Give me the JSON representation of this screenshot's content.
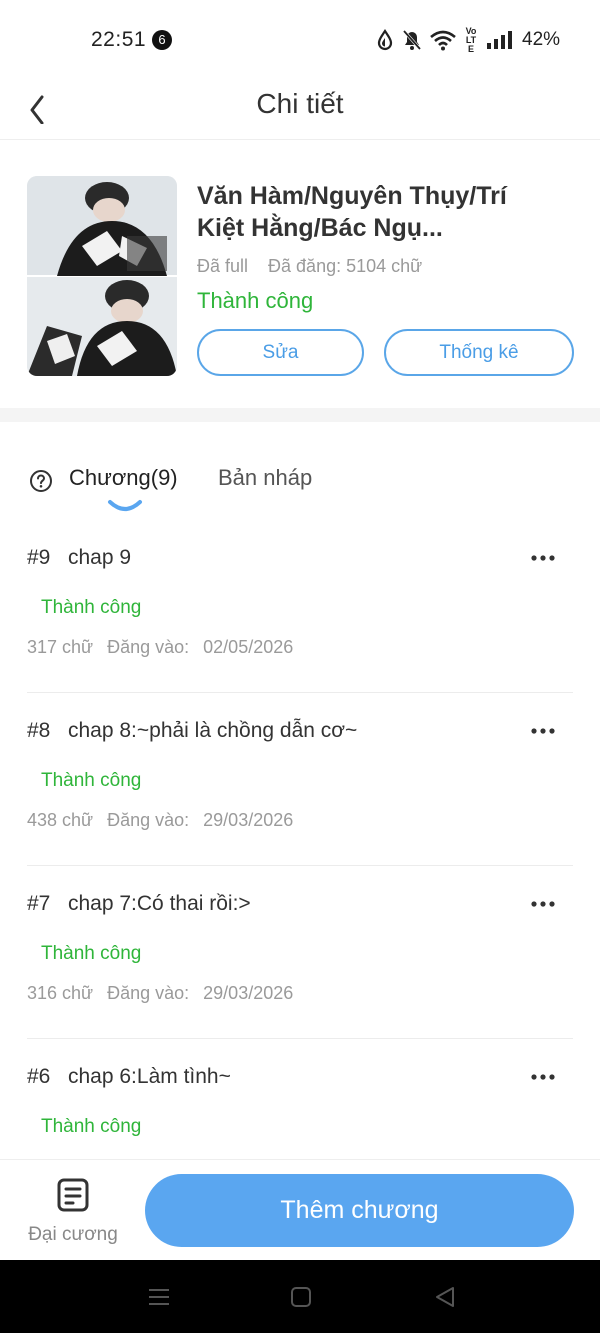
{
  "status_bar": {
    "time": "22:51",
    "notification_count": "6",
    "volte": "Vo LTE",
    "battery": "42%"
  },
  "header": {
    "title": "Chi tiết"
  },
  "book": {
    "title": "Văn Hàm/Nguyên Thụy/Trí Kiệt Hằng/Bác Ngụ...",
    "completion": "Đã full",
    "posted_words": "Đã đăng: 5104 chữ",
    "status": "Thành  công",
    "edit_label": "Sửa",
    "stats_label": "Thống kê"
  },
  "tabs": [
    {
      "label": "Chương(9)",
      "active": true
    },
    {
      "label": "Bản nháp",
      "active": false
    }
  ],
  "chapters": [
    {
      "number": "#9",
      "title": "chap 9",
      "status": "Thành công",
      "words": "317 chữ",
      "posted_label": "Đăng vào:",
      "date": "02/05/2026"
    },
    {
      "number": "#8",
      "title": "chap 8:~phải là chồng dẫn cơ~",
      "status": "Thành công",
      "words": "438 chữ",
      "posted_label": "Đăng vào:",
      "date": "29/03/2026"
    },
    {
      "number": "#7",
      "title": "chap 7:Có thai rồi:>",
      "status": "Thành công",
      "words": "316 chữ",
      "posted_label": "Đăng vào:",
      "date": "29/03/2026"
    },
    {
      "number": "#6",
      "title": "chap 6:Làm tình~",
      "status": "Thành công",
      "words": "",
      "posted_label": "",
      "date": ""
    }
  ],
  "bottom_bar": {
    "outline_label": "Đại cương",
    "add_chapter_label": "Thêm chương"
  },
  "colors": {
    "accent": "#5aa6f0",
    "success": "#2fb53a",
    "muted": "#9a9a9a"
  },
  "icons": [
    "back-arrow-icon",
    "help-circle-icon",
    "more-dots-icon",
    "document-icon",
    "menu-icon",
    "home-square-icon",
    "back-triangle-icon"
  ]
}
